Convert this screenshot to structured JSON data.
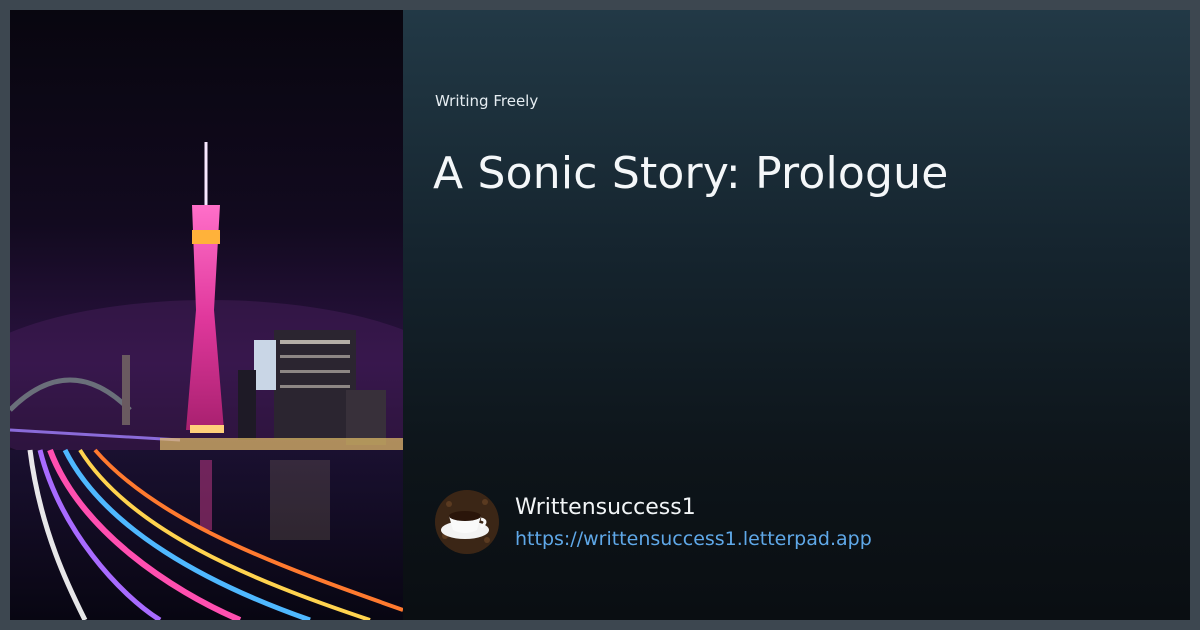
{
  "card": {
    "image_alt": "Canton Tower lit in pink at night beside a river with long-exposure light trails",
    "site_name": "Writing Freely",
    "title": "A Sonic Story: Prologue"
  },
  "author": {
    "name": "Writtensuccess1",
    "url": "https://writtensuccess1.letterpad.app",
    "avatar_icon": "coffee-cup-icon"
  },
  "colors": {
    "page_border": "#3d4750",
    "panel_top": "#223946",
    "panel_bottom": "#0a0e12",
    "link": "#5fa8e8",
    "tower": "#e0389c"
  }
}
